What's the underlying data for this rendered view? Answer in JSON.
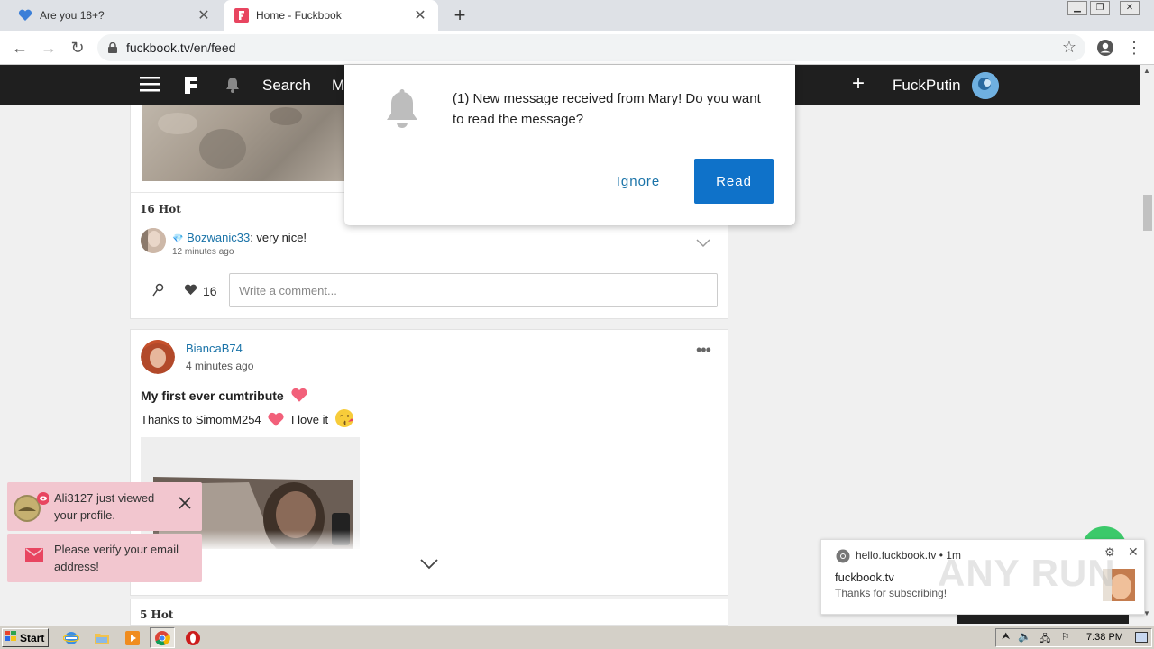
{
  "browser": {
    "tabs": [
      {
        "title": "Are you 18+?",
        "active": false
      },
      {
        "title": "Home - Fuckbook",
        "active": true
      }
    ],
    "url": "fuckbook.tv/en/feed"
  },
  "site_nav": {
    "search_label": "Search",
    "partial_label": "M",
    "username": "FuckPutin"
  },
  "post1": {
    "hot_count_label": "16 Hot",
    "comment": {
      "author": "Bozwanic33",
      "text": ": very nice!",
      "time": "12 minutes ago"
    },
    "like_count": "16",
    "comment_placeholder": "Write a comment..."
  },
  "post2": {
    "author": "BiancaB74",
    "time": "4 minutes ago",
    "title": "My first ever cumtribute",
    "body_text": "Thanks to SimomM254",
    "body_text2": "I love it"
  },
  "post3": {
    "hot_count_label": "5 Hot"
  },
  "modal": {
    "message": "(1) New message received from Mary! Do you want to read the message?",
    "ignore_label": "Ignore",
    "read_label": "Read"
  },
  "toasts": [
    {
      "text": "Ali3127 just viewed your profile."
    },
    {
      "text": "Please verify your email address!"
    }
  ],
  "chrome_notification": {
    "origin": "hello.fuckbook.tv",
    "age": "1m",
    "title": "fuckbook.tv",
    "body": "Thanks for subscribing!"
  },
  "watermark": "ANY RUN",
  "taskbar": {
    "start_label": "Start",
    "clock": "7:38 PM"
  },
  "colors": {
    "accent": "#0f72c9",
    "link": "#1a73a8",
    "nav_bg": "#1f1f1f",
    "toast_bg": "#f2c6cf",
    "heart": "#f2607a"
  }
}
